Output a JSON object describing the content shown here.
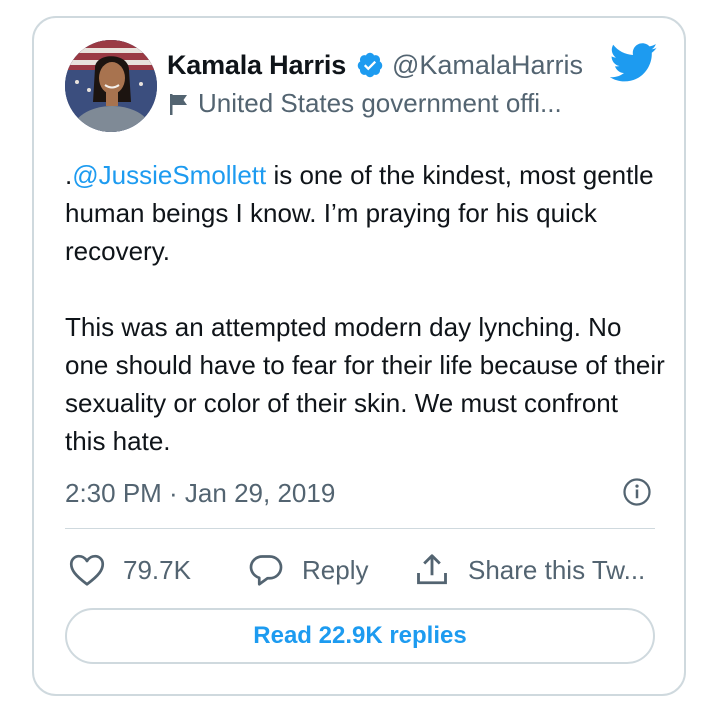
{
  "author": {
    "name": "Kamala Harris",
    "handle": "@KamalaHarris",
    "label": "United States government offi..."
  },
  "tweet": {
    "mention": "@JussieSmollett",
    "prefix": ".",
    "paragraph1_rest": " is one of the kindest, most gentle human beings I know. I’m praying for his quick recovery.",
    "paragraph2": "This was an attempted modern day lynching. No one should have to fear for their life because of their sexuality or color of their skin. We must confront this hate.",
    "timestamp": "2:30 PM · Jan 29, 2019"
  },
  "actions": {
    "likes": "79.7K",
    "reply_label": "Reply",
    "share_label": "Share this Tw..."
  },
  "read_replies_label": "Read 22.9K replies",
  "icons": {
    "verified": "verified-badge-icon",
    "bird": "twitter-bird-icon",
    "flag": "flag-icon",
    "info": "info-icon",
    "like": "heart-icon",
    "reply": "speech-bubble-icon",
    "share": "share-upload-icon"
  },
  "colors": {
    "accent": "#1d9bf0",
    "text": "#0f1419",
    "secondary": "#536471",
    "border": "#cfd9de"
  }
}
